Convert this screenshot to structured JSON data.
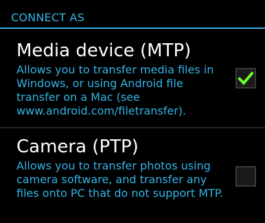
{
  "section": {
    "title": "CONNECT AS"
  },
  "options": [
    {
      "title": "Media device (MTP)",
      "description": "Allows you to transfer media files in Windows, or using Android file transfer on a Mac (see www.android.com/filetransfer).",
      "checked": true
    },
    {
      "title": "Camera (PTP)",
      "description": "Allows you to transfer photos using camera software, and transfer any files onto PC that do not support MTP.",
      "checked": false
    }
  ],
  "colors": {
    "background": "#000000",
    "accent": "#33b5e5",
    "checkmark": "#6cff2b",
    "title_text": "#ffffff"
  },
  "icons": {
    "checked": "check-icon"
  }
}
